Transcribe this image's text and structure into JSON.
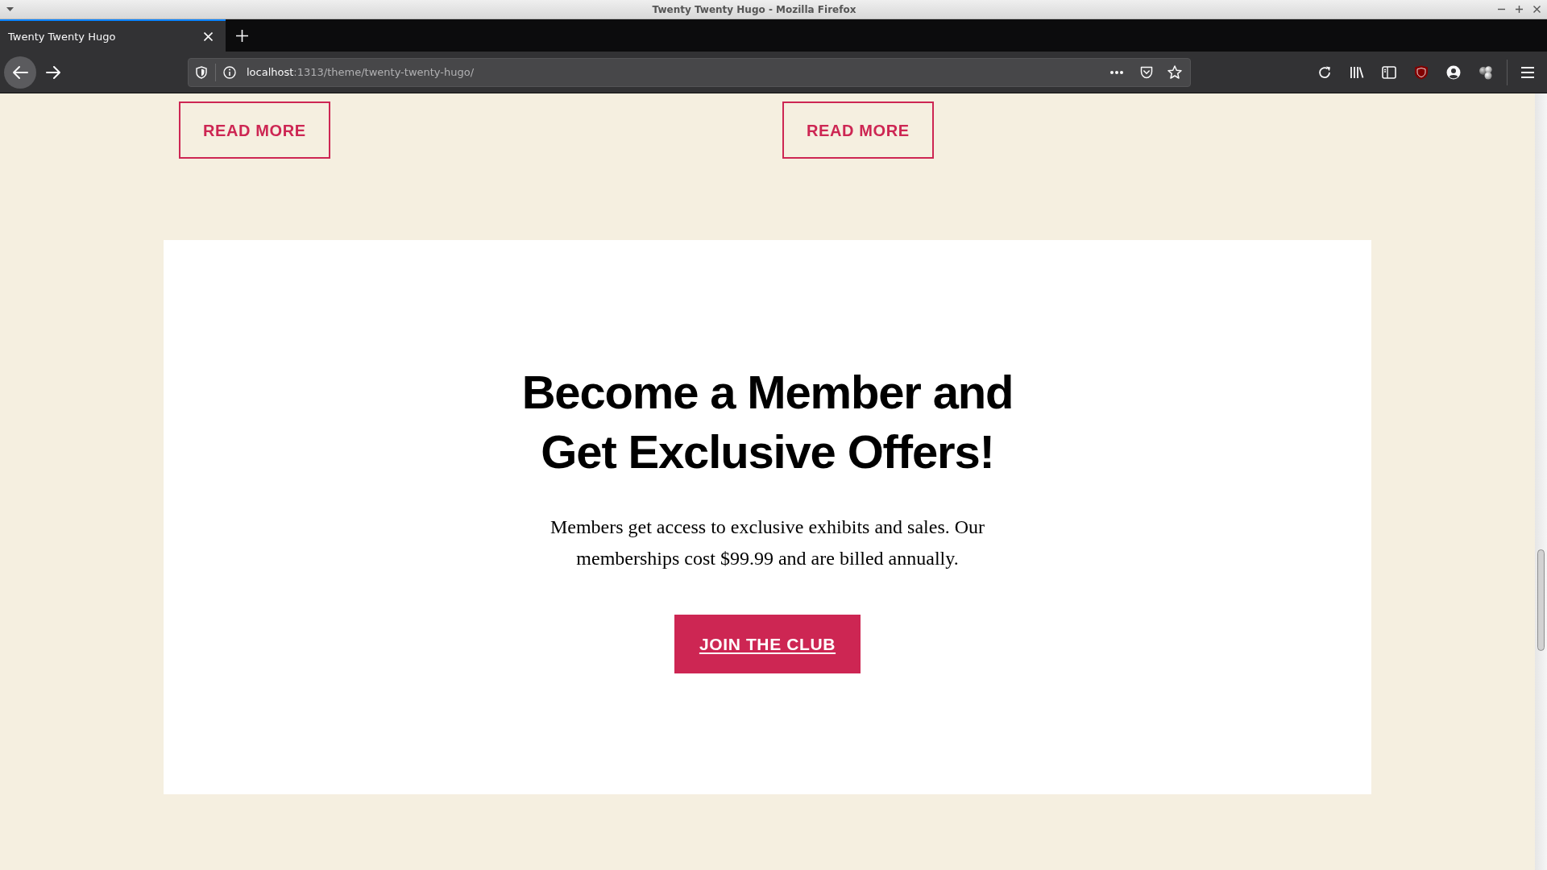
{
  "window": {
    "title": "Twenty Twenty Hugo - Mozilla Firefox"
  },
  "tabs": [
    {
      "label": "Twenty Twenty Hugo",
      "selected": true
    }
  ],
  "address_bar": {
    "host": "localhost",
    "path": ":1313/theme/twenty-twenty-hugo/"
  },
  "page": {
    "posts": [
      {
        "button": "READ MORE"
      },
      {
        "button": "READ MORE"
      }
    ],
    "membership": {
      "heading": "Become a Member and Get Exclusive Offers!",
      "text": "Members get access to exclusive exhibits and sales. Our memberships cost $99.99 and are billed annually.",
      "button": "JOIN THE CLUB"
    }
  }
}
